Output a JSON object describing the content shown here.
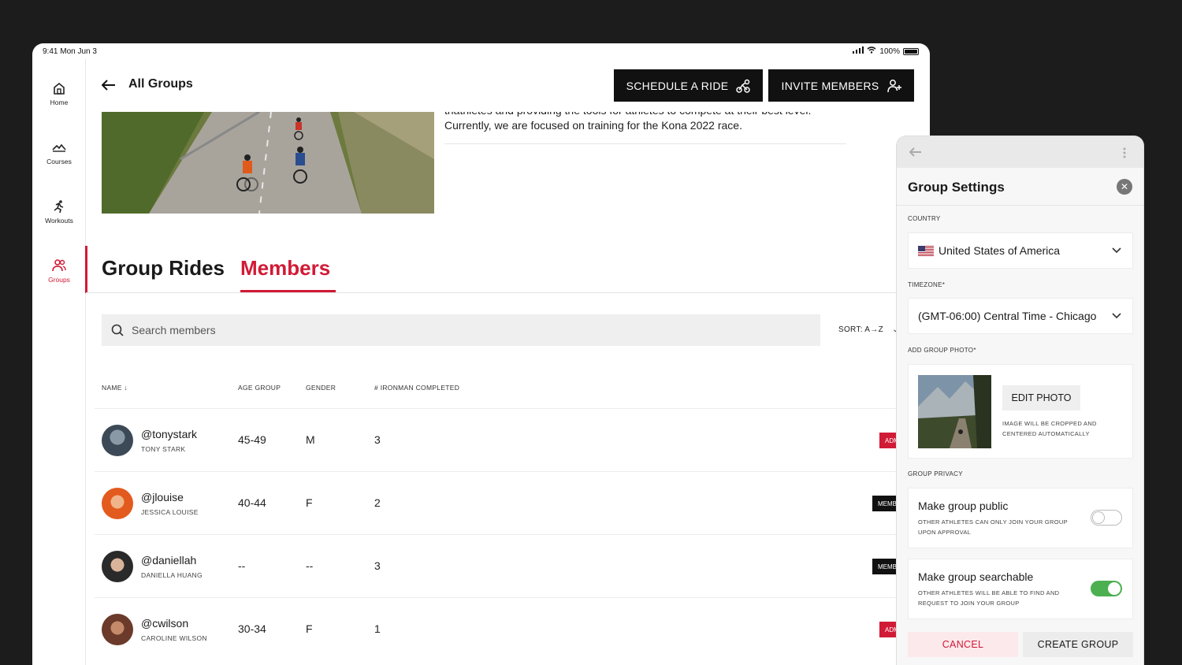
{
  "status_bar": {
    "time": "9:41  Mon Jun 3",
    "battery": "100%"
  },
  "sidebar": {
    "items": [
      {
        "label": "Home",
        "icon": "home-icon"
      },
      {
        "label": "Courses",
        "icon": "courses-icon"
      },
      {
        "label": "Workouts",
        "icon": "workouts-icon"
      },
      {
        "label": "Groups",
        "icon": "groups-icon",
        "active": true
      }
    ]
  },
  "header": {
    "title": "All Groups",
    "schedule_label": "SCHEDULE A RIDE",
    "invite_label": "INVITE MEMBERS"
  },
  "group": {
    "description_line1": "triathletes and providing the tools for athletes to compete at their best level.",
    "description_line2": "Currently, we are focused on training for the Kona 2022 race."
  },
  "tabs": [
    {
      "label": "Group Rides",
      "active": false
    },
    {
      "label": "Members",
      "active": true
    }
  ],
  "search": {
    "placeholder": "Search members",
    "sort_label": "SORT: A→Z"
  },
  "table": {
    "headers": [
      "NAME ↓",
      "AGE GROUP",
      "GENDER",
      "# IRONMAN COMPLETED"
    ],
    "rows": [
      {
        "handle": "@tonystark",
        "name": "TONY STARK",
        "age_group": "45-49",
        "gender": "M",
        "ironman": "3",
        "role": "ADMIN"
      },
      {
        "handle": "@jlouise",
        "name": "JESSICA LOUISE",
        "age_group": "40-44",
        "gender": "F",
        "ironman": "2",
        "role": "MEMBER"
      },
      {
        "handle": "@daniellah",
        "name": "DANIELLA HUANG",
        "age_group": "--",
        "gender": "--",
        "ironman": "3",
        "role": "MEMBER"
      },
      {
        "handle": "@cwilson",
        "name": "CAROLINE WILSON",
        "age_group": "30-34",
        "gender": "F",
        "ironman": "1",
        "role": "ADMIN"
      }
    ]
  },
  "settings": {
    "title": "Group Settings",
    "country_label": "COUNTRY",
    "country_value": "United States of America",
    "timezone_label": "TIMEZONE*",
    "timezone_value": "(GMT-06:00) Central Time - Chicago",
    "photo_label": "ADD GROUP PHOTO*",
    "edit_photo": "EDIT PHOTO",
    "photo_note": "IMAGE WILL BE CROPPED AND CENTERED AUTOMATICALLY",
    "privacy_label": "GROUP PRIVACY",
    "public_title": "Make group public",
    "public_desc": "OTHER ATHLETES CAN ONLY JOIN YOUR GROUP UPON APPROVAL",
    "public_on": false,
    "searchable_title": "Make group searchable",
    "searchable_desc": "OTHER ATHLETES WILL BE ABLE TO FIND AND REQUEST TO JOIN YOUR GROUP",
    "searchable_on": true,
    "cancel": "CANCEL",
    "create": "CREATE GROUP"
  },
  "colors": {
    "accent": "#d11a36",
    "toggle_on": "#4caf50",
    "dark_button": "#111111"
  }
}
